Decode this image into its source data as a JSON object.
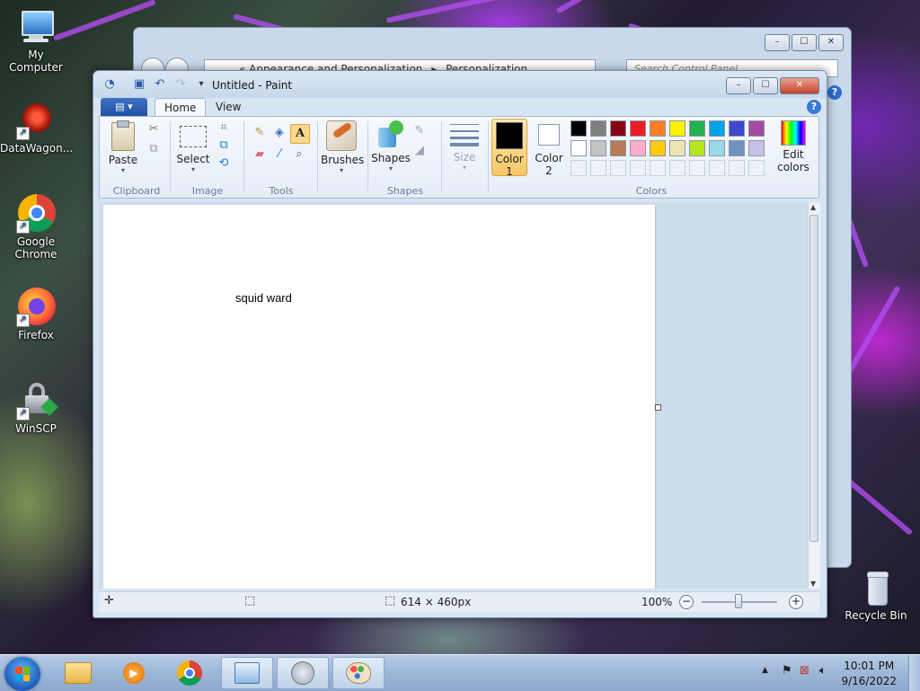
{
  "desktop": {
    "icons": [
      {
        "label": "My Computer",
        "icon": "computer-icon"
      },
      {
        "label": "DataWagon...",
        "icon": "datawagon-icon"
      },
      {
        "label": "Google Chrome",
        "icon": "chrome-icon"
      },
      {
        "label": "Firefox",
        "icon": "firefox-icon"
      },
      {
        "label": "WinSCP",
        "icon": "winscp-icon"
      },
      {
        "label": "Recycle Bin",
        "icon": "recycle-bin-icon"
      }
    ]
  },
  "control_panel": {
    "address": {
      "prefix": "«",
      "segment1": "Appearance and Personalization",
      "separator": "▸",
      "segment2": "Personalization"
    },
    "search_placeholder": "Search Control Panel",
    "controls": {
      "minimize": "–",
      "maximize": "☐",
      "close": "✕"
    }
  },
  "paint": {
    "title": "Untitled - Paint",
    "controls": {
      "minimize": "–",
      "maximize": "☐",
      "close": "✕"
    },
    "tabs": [
      {
        "label": "Home",
        "active": true
      },
      {
        "label": "View",
        "active": false
      }
    ],
    "ribbon": {
      "clipboard": {
        "paste": "Paste",
        "group": "Clipboard"
      },
      "image": {
        "select": "Select",
        "group": "Image"
      },
      "tools": {
        "group": "Tools"
      },
      "brushes": {
        "label": "Brushes"
      },
      "shapes": {
        "label": "Shapes",
        "group": "Shapes"
      },
      "size": {
        "label": "Size"
      },
      "colors": {
        "color1_line1": "Color",
        "color1_line2": "1",
        "color2_line1": "Color",
        "color2_line2": "2",
        "edit_line1": "Edit",
        "edit_line2": "colors",
        "group": "Colors",
        "color1": "#000000",
        "color2": "#ffffff",
        "palette_row1": [
          "#000000",
          "#7f7f7f",
          "#880015",
          "#ed1c24",
          "#ff7f27",
          "#fff200",
          "#22b14c",
          "#00a2e8",
          "#3f48cc",
          "#a349a4"
        ],
        "palette_row2": [
          "#ffffff",
          "#c3c3c3",
          "#b97a57",
          "#ffaec9",
          "#ffc90e",
          "#efe4b0",
          "#b5e61d",
          "#99d9ea",
          "#7092be",
          "#c8bfe7"
        ]
      }
    },
    "canvas": {
      "text": "squid ward"
    },
    "status": {
      "dimensions": "614 × 460px",
      "zoom": "100%"
    }
  },
  "taskbar": {
    "items": [
      {
        "name": "explorer-taskbar-button",
        "icon": "folder-icon",
        "glyph": "📁"
      },
      {
        "name": "media-player-taskbar-button",
        "icon": "media-player-icon",
        "glyph": "▶"
      },
      {
        "name": "chrome-taskbar-button",
        "icon": "chrome-icon",
        "glyph": "◉"
      },
      {
        "name": "control-panel-taskbar-button",
        "icon": "control-panel-icon",
        "glyph": "▦"
      },
      {
        "name": "sound-taskbar-button",
        "icon": "speaker-icon",
        "glyph": "◎"
      },
      {
        "name": "paint-taskbar-button",
        "icon": "paint-icon",
        "glyph": "🎨"
      }
    ],
    "clock": {
      "time": "10:01 PM",
      "date": "9/16/2022"
    }
  }
}
